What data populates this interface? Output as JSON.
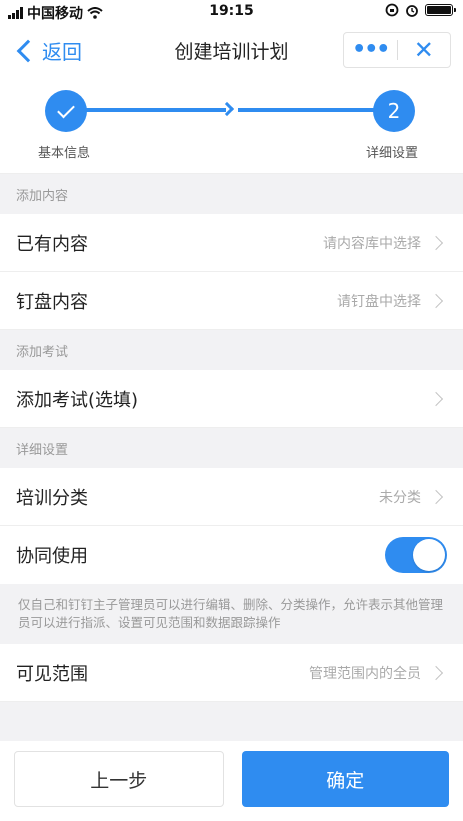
{
  "status_bar": {
    "carrier": "中国移动",
    "time": "19:15"
  },
  "nav": {
    "back_label": "返回",
    "title": "创建培训计划",
    "more_icon": "more-dots-icon",
    "close_icon": "close-icon"
  },
  "stepper": {
    "steps": [
      {
        "label": "基本信息",
        "state": "done"
      },
      {
        "number": "2",
        "label": "详细设置",
        "state": "current"
      }
    ]
  },
  "sections": {
    "add_content": {
      "header": "添加内容",
      "rows": [
        {
          "label": "已有内容",
          "value": "请内容库中选择"
        },
        {
          "label": "钉盘内容",
          "value": "请钉盘中选择"
        }
      ]
    },
    "add_exam": {
      "header": "添加考试",
      "rows": [
        {
          "label": "添加考试(选填)",
          "value": ""
        }
      ]
    },
    "detail": {
      "header": "详细设置",
      "category": {
        "label": "培训分类",
        "value": "未分类"
      },
      "collab": {
        "label": "协同使用",
        "enabled": true
      },
      "note": "仅自己和钉钉主子管理员可以进行编辑、删除、分类操作，允许表示其他管理员可以进行指派、设置可见范围和数据跟踪操作",
      "visibility": {
        "label": "可见范围",
        "value": "管理范围内的全员"
      }
    }
  },
  "bottom": {
    "prev_label": "上一步",
    "confirm_label": "确定"
  },
  "colors": {
    "accent": "#2f8cf0"
  }
}
